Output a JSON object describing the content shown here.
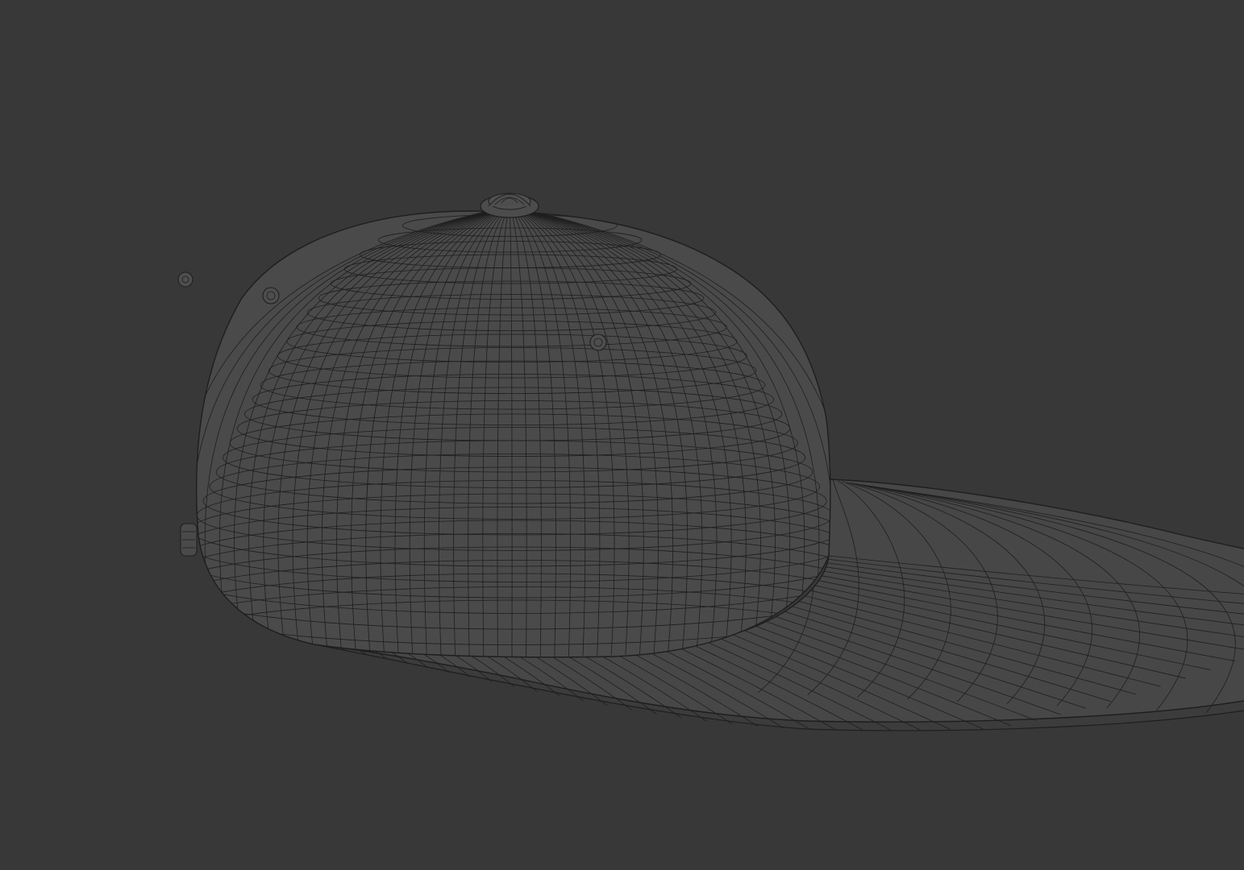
{
  "scene": {
    "background_color": "#383838",
    "wireframe_color": "#1e1e1e",
    "surface_color": "#4a4a4a",
    "underside_color": "#3f3f3f",
    "object": "cap-wireframe-model"
  }
}
